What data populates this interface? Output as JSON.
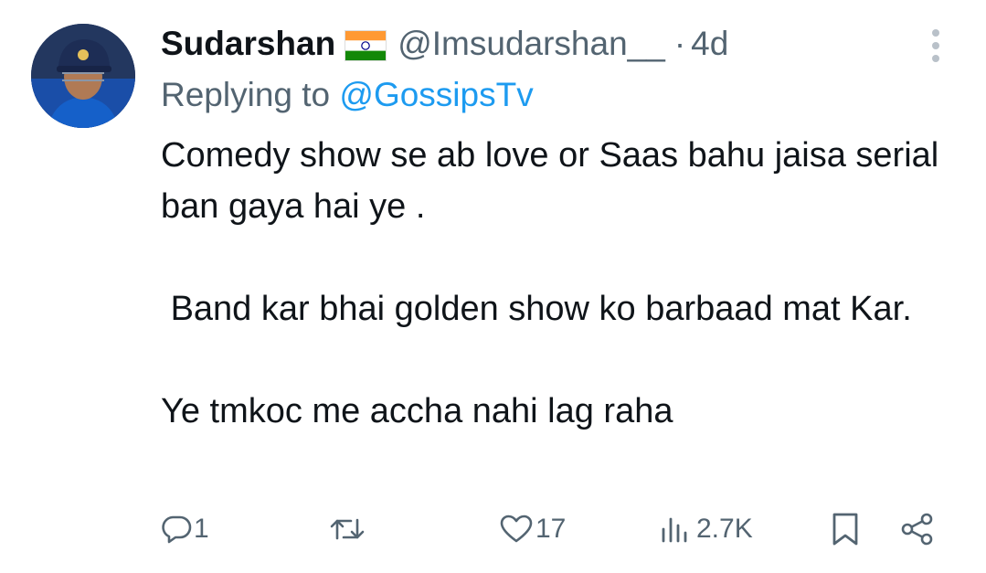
{
  "tweet": {
    "display_name": "Sudarshan",
    "flag_emoji": "india-flag",
    "handle": "@Imsudarshan__",
    "separator": "·",
    "time": "4d",
    "replying_prefix": "Replying to ",
    "replying_handle": "@GossipsTv",
    "paragraphs": [
      "Comedy show se ab love or Saas bahu jaisa serial ban gaya hai ye .",
      " Band kar bhai golden show ko barbaad mat Kar.",
      "Ye tmkoc me accha nahi lag raha"
    ]
  },
  "actions": {
    "reply_count": "1",
    "retweet_count": "",
    "like_count": "17",
    "views_count": "2.7K"
  },
  "icons": {
    "more": "more-vertical-icon",
    "reply": "reply-icon",
    "retweet": "retweet-icon",
    "like": "heart-icon",
    "views": "views-icon",
    "bookmark": "bookmark-icon",
    "share": "share-icon"
  },
  "colors": {
    "text": "#0f1419",
    "secondary": "#536471",
    "link": "#1d9bf0"
  }
}
